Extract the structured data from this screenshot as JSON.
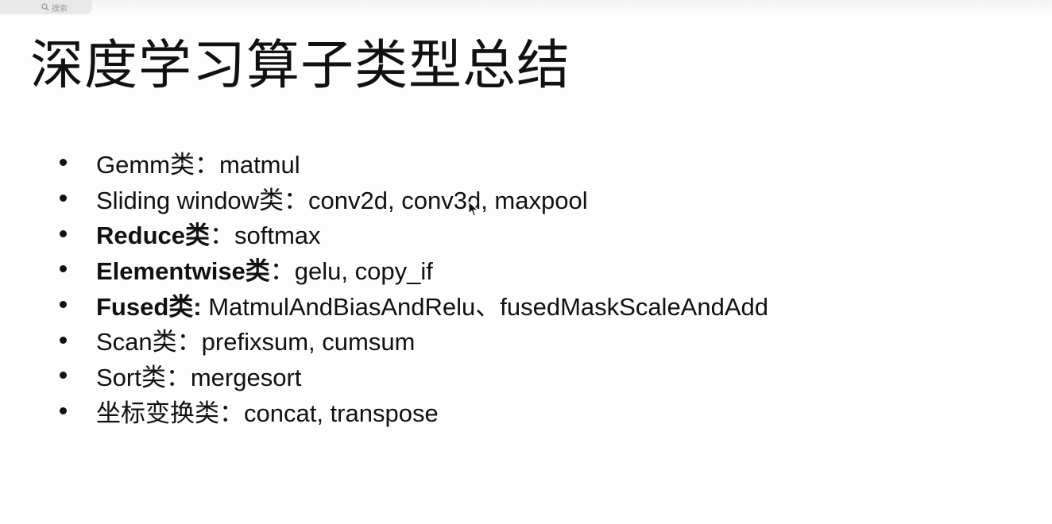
{
  "search": {
    "label": "搜索",
    "icon": "search-icon"
  },
  "slide": {
    "title": "深度学习算子类型总结",
    "items": [
      {
        "bold": "",
        "rest": "Gemm类：matmul"
      },
      {
        "bold": "",
        "rest": "Sliding window类：conv2d, conv3d, maxpool"
      },
      {
        "bold": "Reduce类",
        "rest": "：softmax"
      },
      {
        "bold": "Elementwise类",
        "rest": "：gelu, copy_if"
      },
      {
        "bold": "Fused类:",
        "rest": " MatmulAndBiasAndRelu、fusedMaskScaleAndAdd"
      },
      {
        "bold": "",
        "rest": "Scan类：prefixsum, cumsum"
      },
      {
        "bold": "",
        "rest": "Sort类：mergesort"
      },
      {
        "bold": "",
        "rest": "坐标变换类：concat, transpose"
      }
    ]
  },
  "cursor": {
    "icon": "mouse-pointer-icon"
  },
  "colors": {
    "text": "#111111",
    "background": "#fdfdfd",
    "search_pill": "#e9e9e9"
  }
}
